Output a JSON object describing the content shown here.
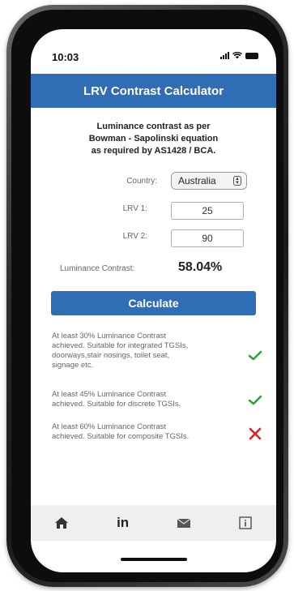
{
  "status_bar": {
    "time": "10:03"
  },
  "app": {
    "title": "LRV Contrast Calculator"
  },
  "intro": {
    "line1": "Luminance contrast as per",
    "line2": "Bowman - Sapolinski equation",
    "line3": "as required by AS1428 / BCA."
  },
  "form": {
    "country_label": "Country:",
    "country_value": "Australia",
    "lrv1_label": "LRV 1:",
    "lrv1_value": "25",
    "lrv2_label": "LRV 2:",
    "lrv2_value": "90",
    "result_label": "Luminance Contrast:",
    "result_value": "58.04%"
  },
  "calculate_label": "Calculate",
  "criteria": [
    {
      "lines": [
        "At least 30% Luminance Contrast",
        "achieved. Suitable for integrated TGSIs,",
        "doorways,stair nosings, toilet seat,",
        "signage etc."
      ],
      "status": "pass"
    },
    {
      "lines": [
        "At least 45% Luminance Contrast",
        "achieved. Suitable for discrete TGSIs."
      ],
      "status": "pass"
    },
    {
      "lines": [
        "At least 60% Luminance Contrast",
        "achieved. Suitable for composite TGSIs."
      ],
      "status": "fail"
    }
  ],
  "tabbar": {
    "items": [
      {
        "icon": "home-icon"
      },
      {
        "icon": "linkedin-icon",
        "label": "in"
      },
      {
        "icon": "mail-icon"
      },
      {
        "icon": "info-icon"
      }
    ]
  },
  "colors": {
    "accent": "#2f6db5",
    "pass": "#2e9e3c",
    "fail": "#e02020"
  }
}
